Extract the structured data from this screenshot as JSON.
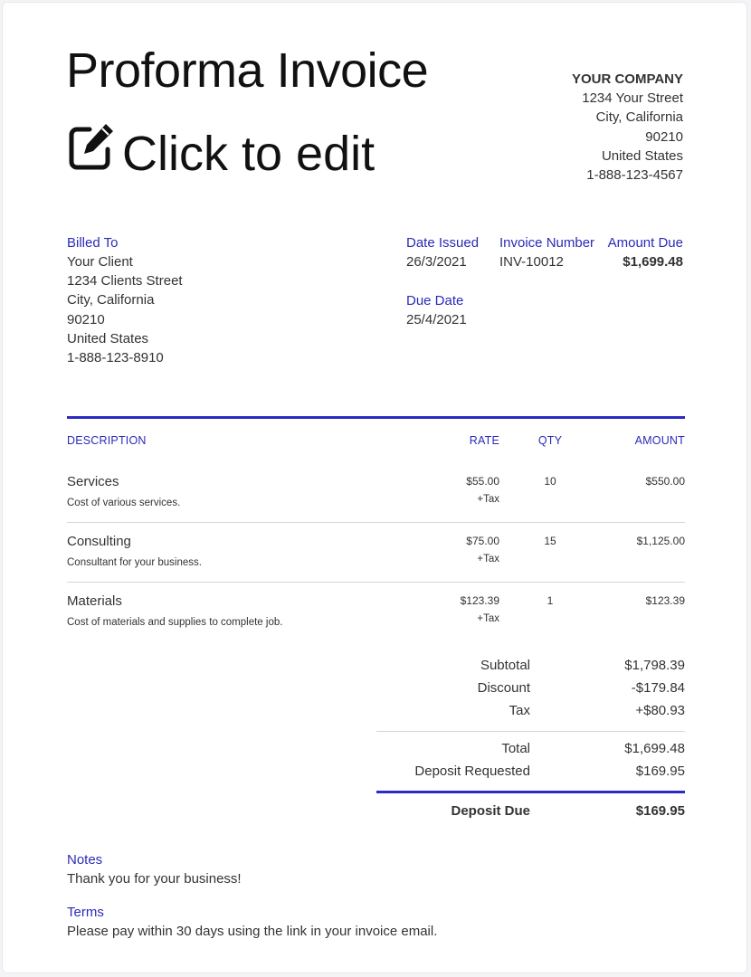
{
  "header": {
    "title": "Proforma Invoice",
    "edit_label": "Click to edit"
  },
  "company": {
    "name": "YOUR COMPANY",
    "street": "1234 Your Street",
    "city": "City, California",
    "zip": "90210",
    "country": "United States",
    "phone": "1-888-123-4567"
  },
  "billed_to": {
    "label": "Billed To",
    "name": "Your Client",
    "street": "1234 Clients Street",
    "city": "City, California",
    "zip": "90210",
    "country": "United States",
    "phone": "1-888-123-8910"
  },
  "meta": {
    "date_issued_label": "Date Issued",
    "date_issued": "26/3/2021",
    "invoice_number_label": "Invoice Number",
    "invoice_number": "INV-10012",
    "amount_due_label": "Amount Due",
    "amount_due": "$1,699.48",
    "due_date_label": "Due Date",
    "due_date": "25/4/2021"
  },
  "table": {
    "headers": {
      "description": "DESCRIPTION",
      "rate": "RATE",
      "qty": "QTY",
      "amount": "AMOUNT"
    },
    "items": [
      {
        "name": "Services",
        "desc": "Cost of various services.",
        "rate": "$55.00",
        "tax": "+Tax",
        "qty": "10",
        "amount": "$550.00"
      },
      {
        "name": "Consulting",
        "desc": "Consultant for your business.",
        "rate": "$75.00",
        "tax": "+Tax",
        "qty": "15",
        "amount": "$1,125.00"
      },
      {
        "name": "Materials",
        "desc": "Cost of materials and supplies to complete job.",
        "rate": "$123.39",
        "tax": "+Tax",
        "qty": "1",
        "amount": "$123.39"
      }
    ]
  },
  "summary": {
    "subtotal_label": "Subtotal",
    "subtotal": "$1,798.39",
    "discount_label": "Discount",
    "discount": "-$179.84",
    "tax_label": "Tax",
    "tax": "+$80.93",
    "total_label": "Total",
    "total": "$1,699.48",
    "deposit_requested_label": "Deposit Requested",
    "deposit_requested": "$169.95",
    "deposit_due_label": "Deposit Due",
    "deposit_due": "$169.95"
  },
  "notes": {
    "label": "Notes",
    "text": "Thank you for your business!"
  },
  "terms": {
    "label": "Terms",
    "text": "Please pay within 30 days using the link in your invoice email."
  },
  "colors": {
    "accent": "#2b2bc4",
    "text": "#333333",
    "title": "#111111"
  }
}
